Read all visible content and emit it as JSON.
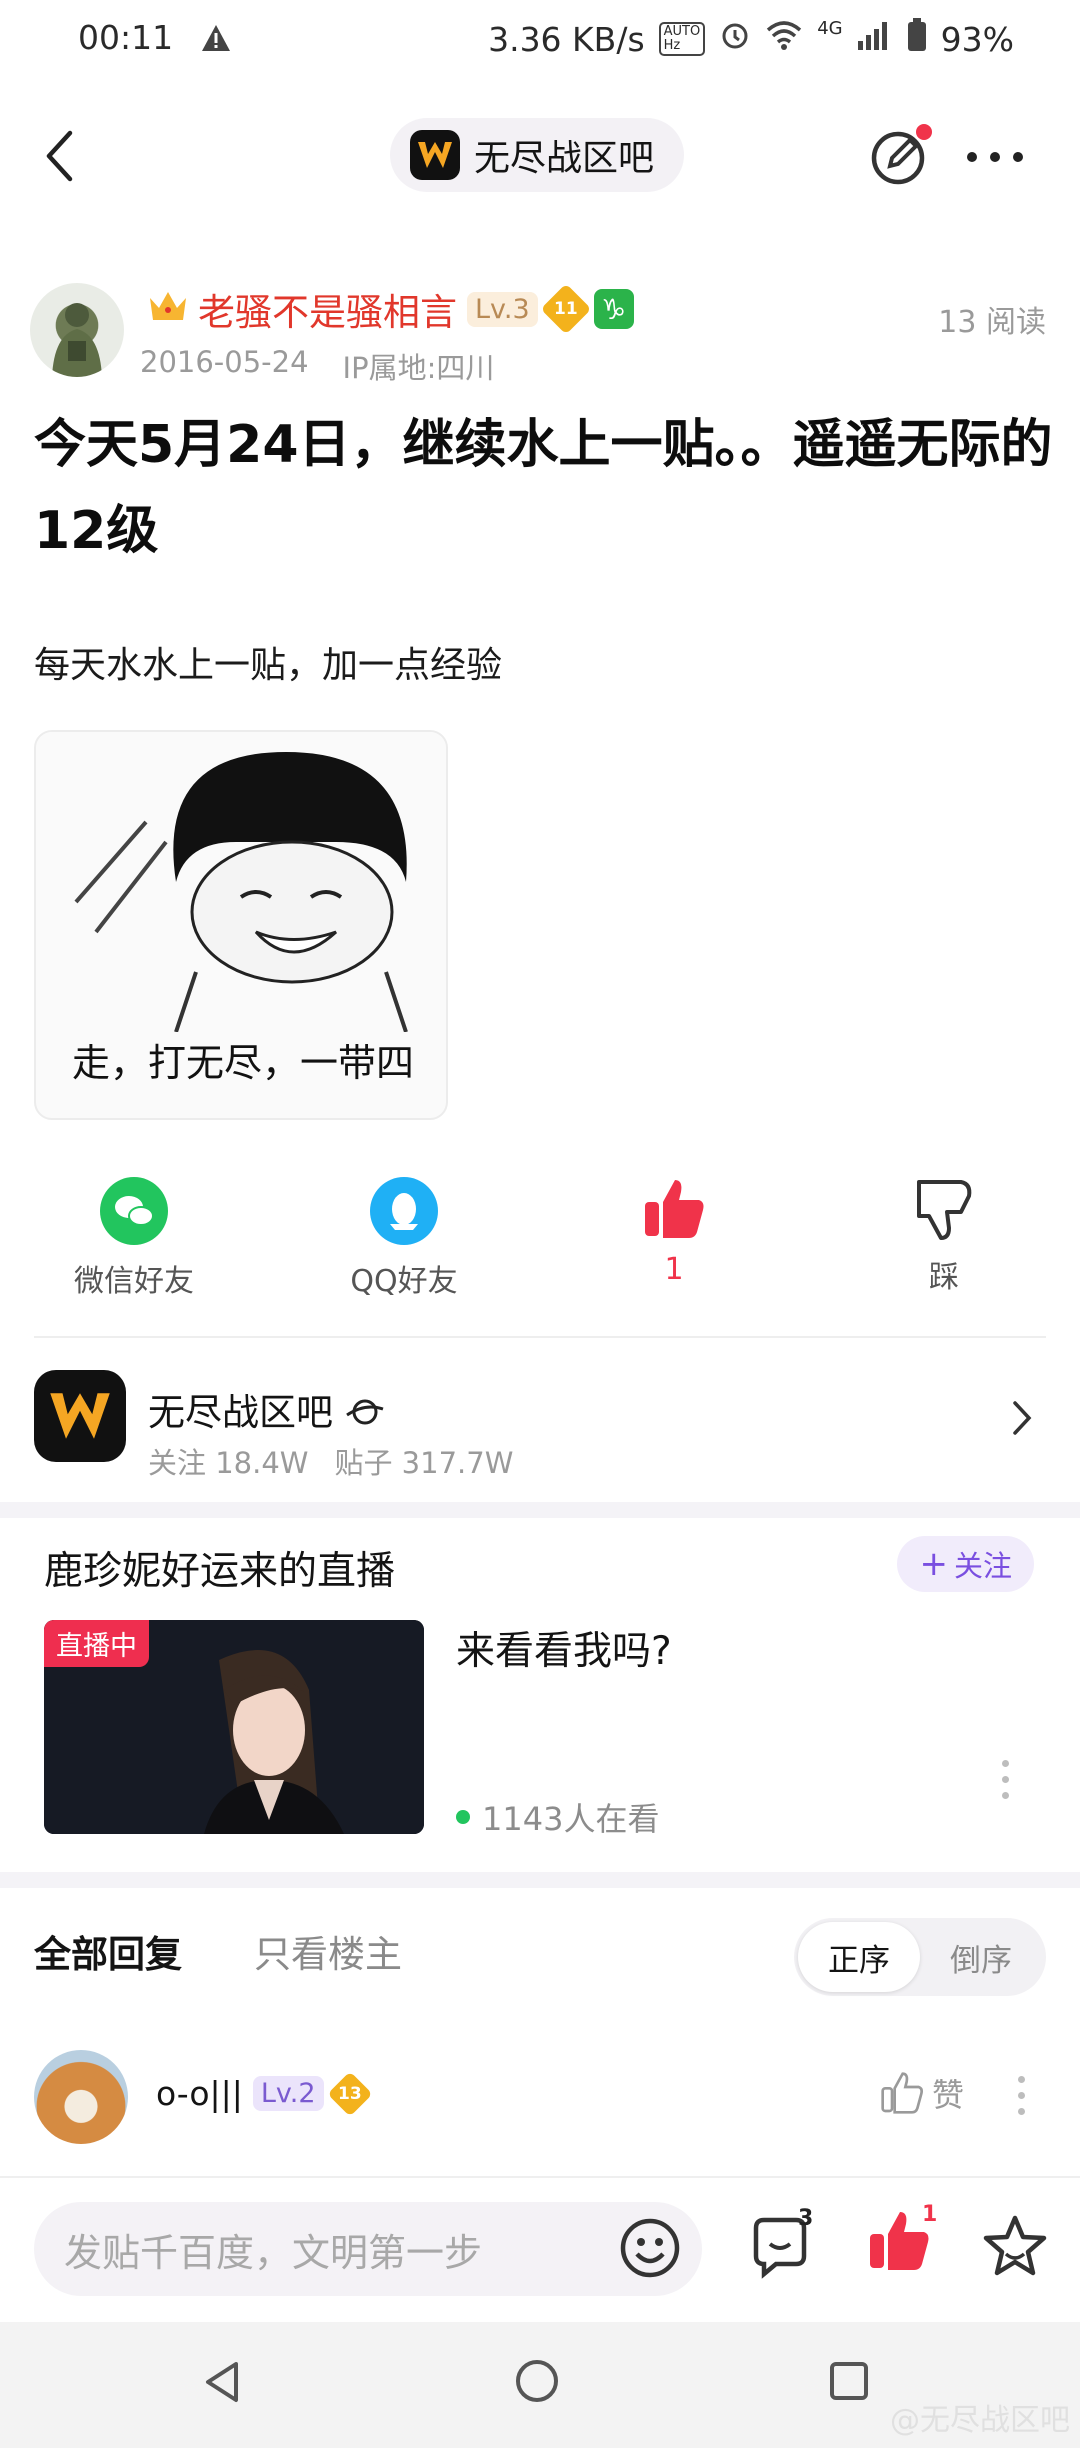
{
  "status_bar": {
    "time": "00:11",
    "speed": "3.36 KB/s",
    "network": "4G",
    "battery": "93%"
  },
  "header": {
    "forum_pill": "无尽战区吧"
  },
  "post": {
    "author": "老骚不是骚相言",
    "author_level": "Lv.3",
    "badge_level": "11",
    "zodiac": "♑",
    "date": "2016-05-24",
    "ip": "IP属地:四川",
    "reads": "13 阅读",
    "title": "今天5月24日，继续水上一贴。。遥遥无际的12级",
    "body": "每天水水上一贴，加一点经验",
    "image_caption": "走，打无尽，一带四"
  },
  "actions": {
    "wechat": "微信好友",
    "qq": "QQ好友",
    "like_count": "1",
    "dislike": "踩"
  },
  "forum": {
    "name": "无尽战区吧",
    "followers": "关注 18.4W",
    "posts": "贴子 317.7W"
  },
  "live": {
    "title": "鹿珍妮好运来的直播",
    "follow": "关注",
    "tag": "直播中",
    "text": "来看看我吗?",
    "viewers": "1143人在看"
  },
  "replies": {
    "tab_all": "全部回复",
    "tab_lz": "只看楼主",
    "sort_asc": "正序",
    "sort_desc": "倒序",
    "first": {
      "name": "o-o|||",
      "level": "Lv.2",
      "badge_level": "13",
      "like": "赞"
    }
  },
  "bottom": {
    "placeholder": "发贴千百度，文明第一步",
    "comment_count": "3",
    "like_count": "1"
  },
  "watermark": "@无尽战区吧",
  "colors": {
    "accent": "#e1372b",
    "like_red": "#f0334a",
    "purple": "#7a4fe0",
    "wechat": "#22c55e",
    "qq": "#1fb0f5"
  }
}
